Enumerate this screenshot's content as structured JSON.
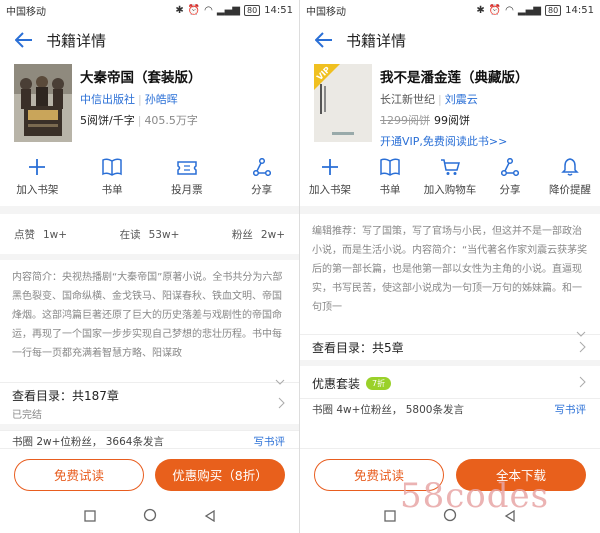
{
  "left": {
    "status": {
      "carrier": "中国移动",
      "battery": "80",
      "time": "14:51"
    },
    "nav": {
      "title": "书籍详情"
    },
    "book": {
      "title": "大秦帝国（套装版）",
      "publisher": "中信出版社",
      "author": "孙皓晖",
      "price": "5阅饼/千字",
      "words": "405.5万字"
    },
    "actions": [
      {
        "label": "加入书架",
        "icon": "plus-icon"
      },
      {
        "label": "书单",
        "icon": "book-icon"
      },
      {
        "label": "投月票",
        "icon": "ticket-icon"
      },
      {
        "label": "分享",
        "icon": "share-icon"
      }
    ],
    "stats": {
      "like_label": "点赞",
      "like_value": "1w+",
      "reading_label": "在读",
      "reading_value": "53w+",
      "fans_label": "粉丝",
      "fans_value": "2w+"
    },
    "intro": "内容简介：央视热播剧“大秦帝国”原著小说。全书共分为六部黑色裂变、国命纵横、金戈铁马、阳谋春秋、铁血文明、帝国烽烟。这部鸿篇巨著还原了巨大的历史落差与戏剧性的帝国命运，再现了一个国家一步步实现自己梦想的悲壮历程。书中每一行每一页都充满着智慧方略、阳谋政",
    "catalog": {
      "title": "查看目录：共187章",
      "sub": "已完结"
    },
    "fan_bar": {
      "text": "书圈 2w+位粉丝， 3664条发言",
      "link": "写书评"
    },
    "buttons": {
      "trial": "免费试读",
      "buy": "优惠购买（8折）"
    }
  },
  "right": {
    "status": {
      "carrier": "中国移动",
      "battery": "80",
      "time": "14:51"
    },
    "nav": {
      "title": "书籍详情"
    },
    "book": {
      "title": "我不是潘金莲（典藏版）",
      "publisher": "长江新世纪",
      "author": "刘震云",
      "old_price": "1299阅饼",
      "price": "99阅饼",
      "vip_link": "开通VIP,免费阅读此书>>",
      "vip_badge": "VIP"
    },
    "actions": [
      {
        "label": "加入书架",
        "icon": "plus-icon"
      },
      {
        "label": "书单",
        "icon": "book-icon"
      },
      {
        "label": "加入购物车",
        "icon": "cart-icon"
      },
      {
        "label": "分享",
        "icon": "share-icon"
      },
      {
        "label": "降价提醒",
        "icon": "bell-icon"
      }
    ],
    "intro": "编辑推荐：写了国策，写了官场与小民，但这并不是一部政治小说，而是生活小说。内容简介：“当代著名作家刘震云获茅奖后的第一部长篇，也是他第一部以女性为主角的小说。直逼现实，书写民苦，使这部小说成为一句顶一万句的姊妹篇。和一句顶一",
    "catalog": {
      "title": "查看目录：共5章"
    },
    "discount": {
      "title": "优惠套装",
      "badge": "7折"
    },
    "fan_bar": {
      "text": "书圈 4w+位粉丝， 5800条发言",
      "link": "写书评"
    },
    "buttons": {
      "trial": "免费试读",
      "buy": "全本下载"
    }
  },
  "watermark": "58codes",
  "colors": {
    "accent": "#e8601c",
    "link": "#2a6fd6",
    "badge": "#9ad12a"
  }
}
